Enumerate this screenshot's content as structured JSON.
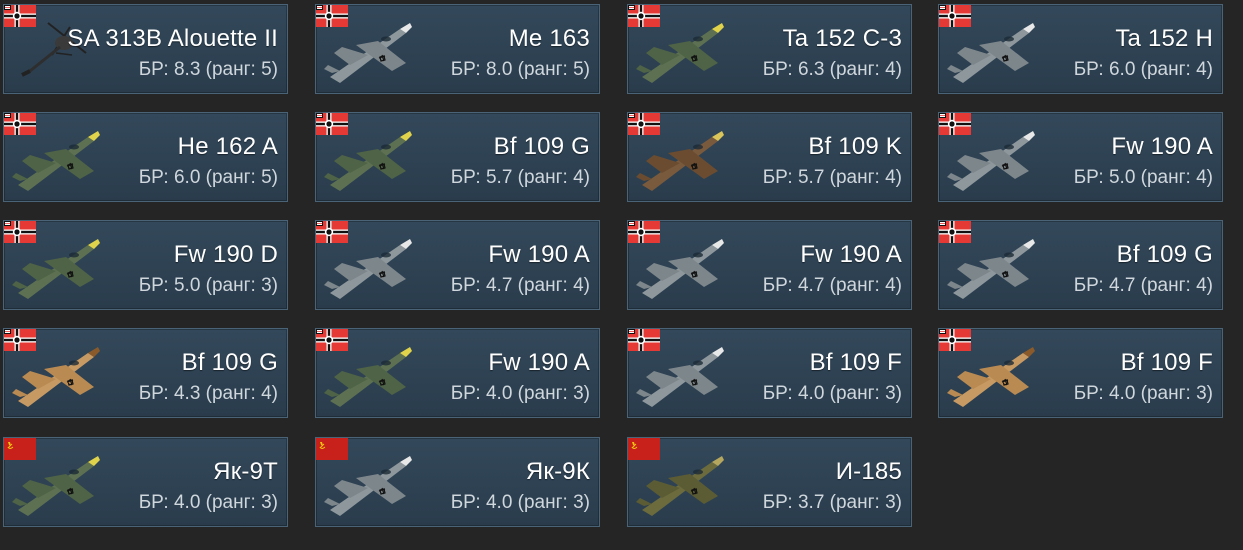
{
  "vehicles": [
    {
      "name": "SA 313B Alouette II",
      "br": "БР: 8.3 (ранг: 5)",
      "nation": "germany",
      "camo": "heli"
    },
    {
      "name": "Me 163",
      "br": "БР: 8.0 (ранг: 5)",
      "nation": "germany",
      "camo": "grey"
    },
    {
      "name": "Ta 152 C-3",
      "br": "БР: 6.3 (ранг: 4)",
      "nation": "germany",
      "camo": "green"
    },
    {
      "name": "Ta 152 H",
      "br": "БР: 6.0 (ранг: 4)",
      "nation": "germany",
      "camo": "grey"
    },
    {
      "name": "He 162 A",
      "br": "БР: 6.0 (ранг: 5)",
      "nation": "germany",
      "camo": "green"
    },
    {
      "name": "Bf 109 G",
      "br": "БР: 5.7 (ранг: 4)",
      "nation": "germany",
      "camo": "green"
    },
    {
      "name": "Bf 109 K",
      "br": "БР: 5.7 (ранг: 4)",
      "nation": "germany",
      "camo": "brown"
    },
    {
      "name": "Fw 190 A",
      "br": "БР: 5.0 (ранг: 4)",
      "nation": "germany",
      "camo": "grey"
    },
    {
      "name": "Fw 190 D",
      "br": "БР: 5.0 (ранг: 3)",
      "nation": "germany",
      "camo": "green"
    },
    {
      "name": "Fw 190 A",
      "br": "БР: 4.7 (ранг: 4)",
      "nation": "germany",
      "camo": "grey"
    },
    {
      "name": "Fw 190 A",
      "br": "БР: 4.7 (ранг: 4)",
      "nation": "germany",
      "camo": "grey"
    },
    {
      "name": "Bf 109 G",
      "br": "БР: 4.7 (ранг: 4)",
      "nation": "germany",
      "camo": "grey"
    },
    {
      "name": "Bf 109 G",
      "br": "БР: 4.3 (ранг: 4)",
      "nation": "germany",
      "camo": "tan"
    },
    {
      "name": "Fw 190 A",
      "br": "БР: 4.0 (ранг: 3)",
      "nation": "germany",
      "camo": "green"
    },
    {
      "name": "Bf 109 F",
      "br": "БР: 4.0 (ранг: 3)",
      "nation": "germany",
      "camo": "grey"
    },
    {
      "name": "Bf 109 F",
      "br": "БР: 4.0 (ранг: 3)",
      "nation": "germany",
      "camo": "tan"
    },
    {
      "name": "Як-9Т",
      "br": "БР: 4.0 (ранг: 3)",
      "nation": "ussr",
      "camo": "green"
    },
    {
      "name": "Як-9К",
      "br": "БР: 4.0 (ранг: 3)",
      "nation": "ussr",
      "camo": "grey"
    },
    {
      "name": "И-185",
      "br": "БР: 3.7 (ранг: 3)",
      "nation": "ussr",
      "camo": "olive"
    }
  ],
  "icons": {
    "germany_flag": "german-war-flag-icon",
    "ussr_flag": "soviet-flag-icon",
    "vehicle": "aircraft-icon"
  },
  "colors": {
    "card_bg": "#2f4354",
    "card_border": "#4a6376",
    "page_bg": "#252525",
    "text_name": "#ffffff",
    "text_br": "#cfd6dc",
    "flag_red": "#d32f2f",
    "soviet_red": "#c8201b",
    "soviet_star": "#f1c40f"
  }
}
